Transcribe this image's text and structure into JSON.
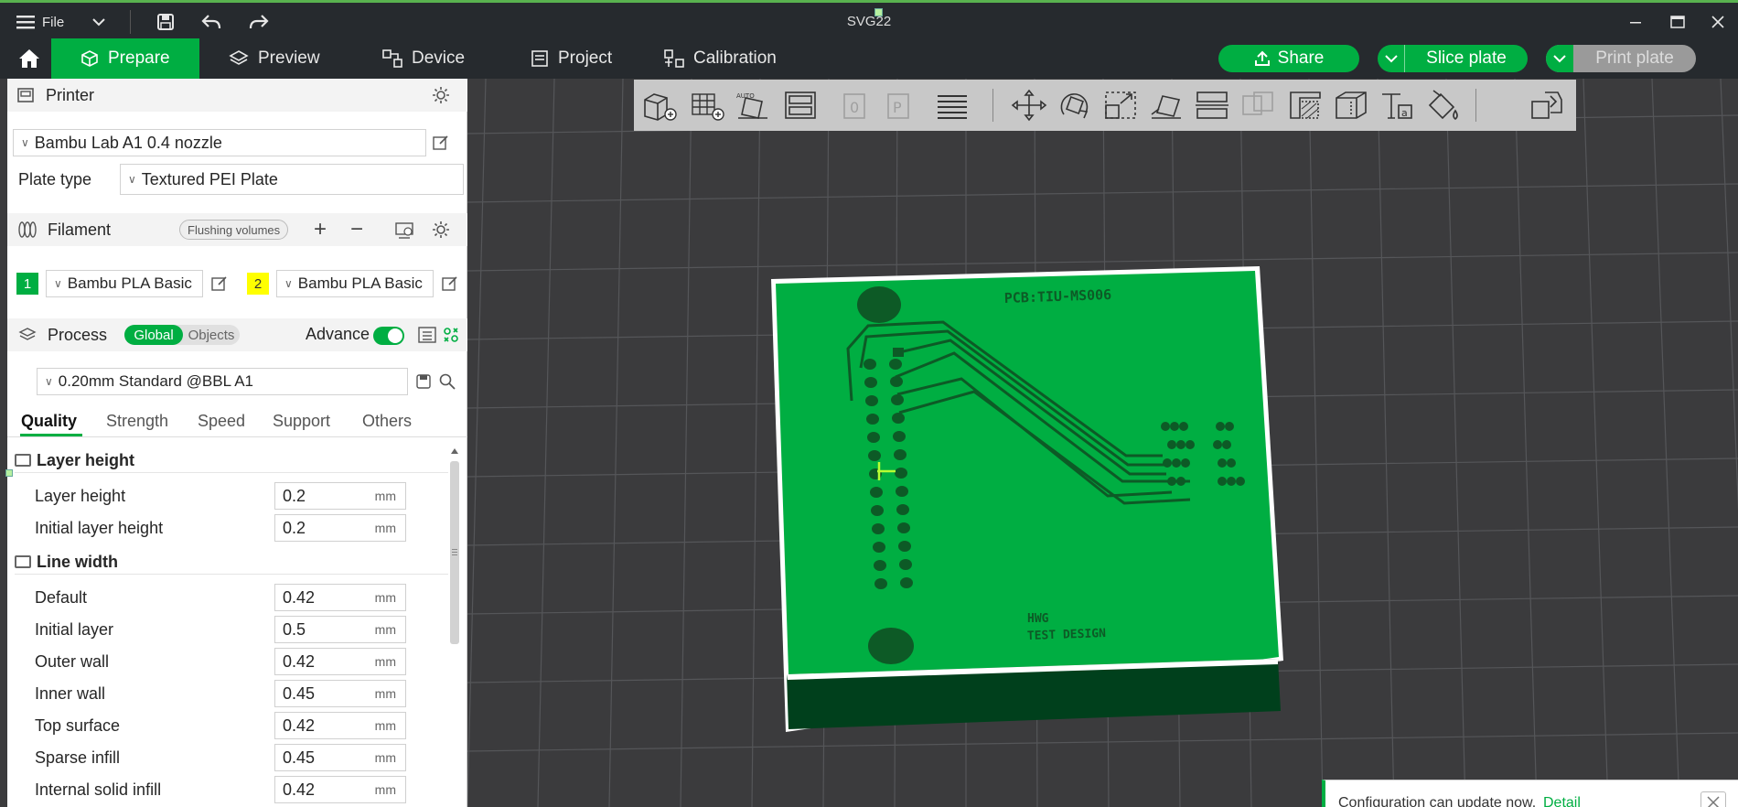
{
  "window": {
    "title": "SVG22",
    "file_label": "File"
  },
  "nav": {
    "tabs": [
      {
        "label": "Prepare"
      },
      {
        "label": "Preview"
      },
      {
        "label": "Device"
      },
      {
        "label": "Project"
      },
      {
        "label": "Calibration"
      }
    ],
    "share_label": "Share",
    "slice_label": "Slice plate",
    "print_label": "Print plate"
  },
  "printer": {
    "header": "Printer",
    "selected": "Bambu Lab A1 0.4 nozzle",
    "plate_type_label": "Plate type",
    "plate_type_value": "Textured PEI Plate"
  },
  "filament": {
    "header": "Filament",
    "flushing_label": "Flushing volumes",
    "slots": [
      {
        "index": "1",
        "name": "Bambu PLA Basic",
        "color": "#00ae42"
      },
      {
        "index": "2",
        "name": "Bambu PLA Basic",
        "color": "#ffff00"
      }
    ]
  },
  "process": {
    "header": "Process",
    "toggle_global": "Global",
    "toggle_objects": "Objects",
    "advance_label": "Advance",
    "preset": "0.20mm Standard @BBL A1"
  },
  "quality_tabs": [
    "Quality",
    "Strength",
    "Speed",
    "Support",
    "Others"
  ],
  "settings": {
    "layer_height_group": "Layer height",
    "line_width_group": "Line width",
    "unit": "mm",
    "layer_rows": [
      {
        "label": "Layer height",
        "value": "0.2"
      },
      {
        "label": "Initial layer height",
        "value": "0.2"
      }
    ],
    "line_rows": [
      {
        "label": "Default",
        "value": "0.42"
      },
      {
        "label": "Initial layer",
        "value": "0.5"
      },
      {
        "label": "Outer wall",
        "value": "0.42"
      },
      {
        "label": "Inner wall",
        "value": "0.45"
      },
      {
        "label": "Top surface",
        "value": "0.42"
      },
      {
        "label": "Sparse infill",
        "value": "0.45"
      },
      {
        "label": "Internal solid infill",
        "value": "0.42"
      }
    ]
  },
  "model": {
    "pcb_label": "PCB:TIU-MS006",
    "logo_text": "HWG",
    "design_text": "TEST DESIGN"
  },
  "notification": {
    "text": "Configuration can update now.",
    "link": "Detail"
  },
  "colors": {
    "accent": "#00ae42",
    "dark_bar": "#262a2e",
    "viewport": "#3b3b3d"
  }
}
